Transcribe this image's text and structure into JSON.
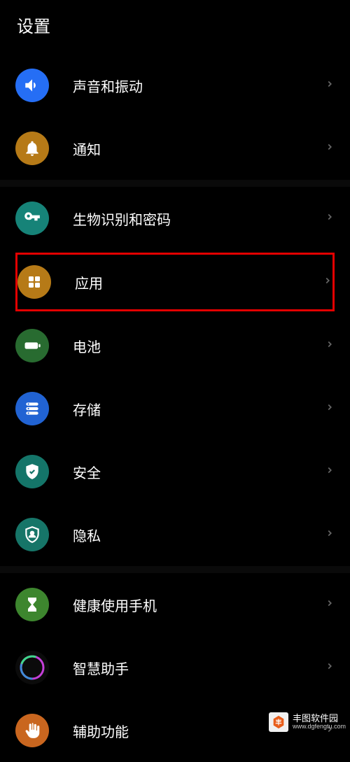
{
  "header": {
    "title": "设置"
  },
  "groups": [
    {
      "items": [
        {
          "id": "sound",
          "label": "声音和振动",
          "iconBg": "bg-blue",
          "icon": "speaker"
        },
        {
          "id": "notifications",
          "label": "通知",
          "iconBg": "bg-amber",
          "icon": "bell"
        }
      ]
    },
    {
      "items": [
        {
          "id": "biometrics",
          "label": "生物识别和密码",
          "iconBg": "bg-teal",
          "icon": "key"
        },
        {
          "id": "apps",
          "label": "应用",
          "iconBg": "bg-amber2",
          "icon": "grid",
          "highlighted": true
        },
        {
          "id": "battery",
          "label": "电池",
          "iconBg": "bg-green",
          "icon": "battery"
        },
        {
          "id": "storage",
          "label": "存储",
          "iconBg": "bg-blue2",
          "icon": "storage"
        },
        {
          "id": "security",
          "label": "安全",
          "iconBg": "bg-teal2",
          "icon": "shield-check"
        },
        {
          "id": "privacy",
          "label": "隐私",
          "iconBg": "bg-teal3",
          "icon": "shield-user"
        }
      ]
    },
    {
      "items": [
        {
          "id": "digital-wellbeing",
          "label": "健康使用手机",
          "iconBg": "bg-green2",
          "icon": "hourglass"
        },
        {
          "id": "assistant",
          "label": "智慧助手",
          "iconBg": "bg-siri",
          "icon": "siri"
        },
        {
          "id": "accessibility",
          "label": "辅助功能",
          "iconBg": "bg-orange",
          "icon": "hand"
        }
      ]
    }
  ],
  "watermark": {
    "name": "丰图软件园",
    "url": "www.dgfengtu.com"
  }
}
